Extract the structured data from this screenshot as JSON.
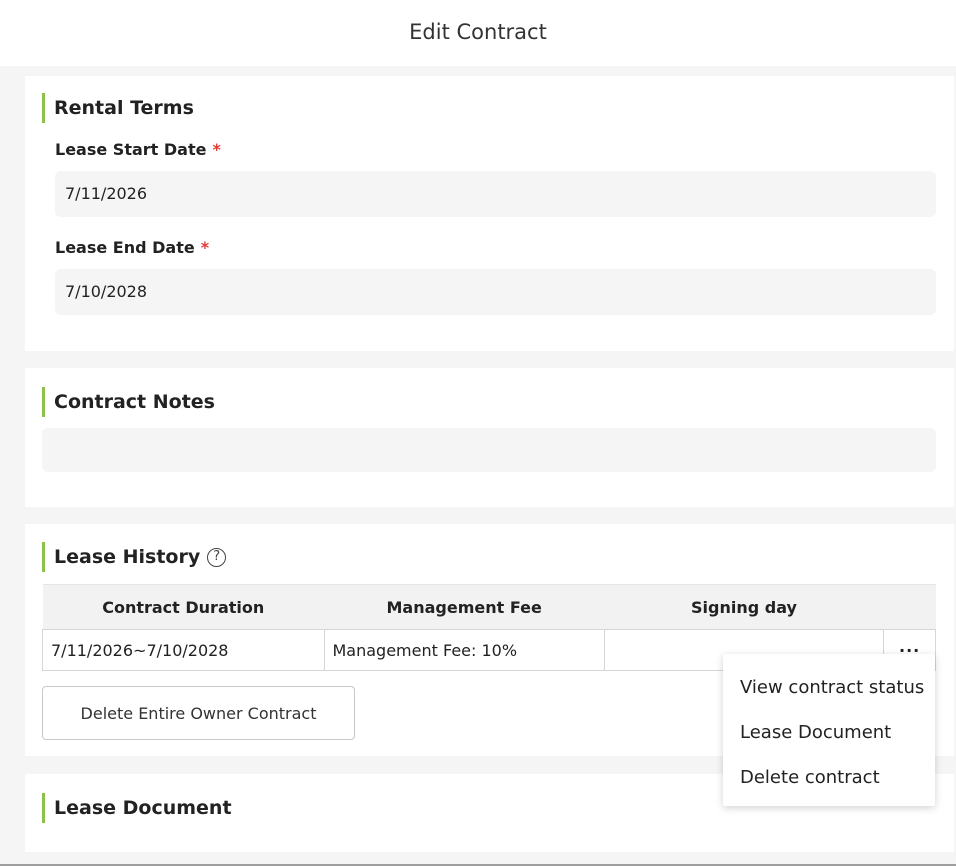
{
  "header": {
    "title": "Edit Contract"
  },
  "rental_terms": {
    "title": "Rental Terms",
    "lease_start": {
      "label": "Lease Start Date",
      "required_mark": "*",
      "value": "7/11/2026"
    },
    "lease_end": {
      "label": "Lease End Date",
      "required_mark": "*",
      "value": "7/10/2028"
    }
  },
  "contract_notes": {
    "title": "Contract Notes",
    "value": ""
  },
  "lease_history": {
    "title": "Lease History",
    "help_glyph": "?",
    "columns": [
      "Contract Duration",
      "Management Fee",
      "Signing day",
      ""
    ],
    "rows": [
      {
        "duration": "7/11/2026~7/10/2028",
        "fee": "Management Fee: 10%",
        "signing_day": "",
        "more": "···"
      }
    ],
    "delete_owner_label": "Delete Entire Owner Contract"
  },
  "row_menu": {
    "items": [
      "View contract status",
      "Lease Document",
      "Delete contract"
    ]
  },
  "lease_document": {
    "title": "Lease Document"
  }
}
